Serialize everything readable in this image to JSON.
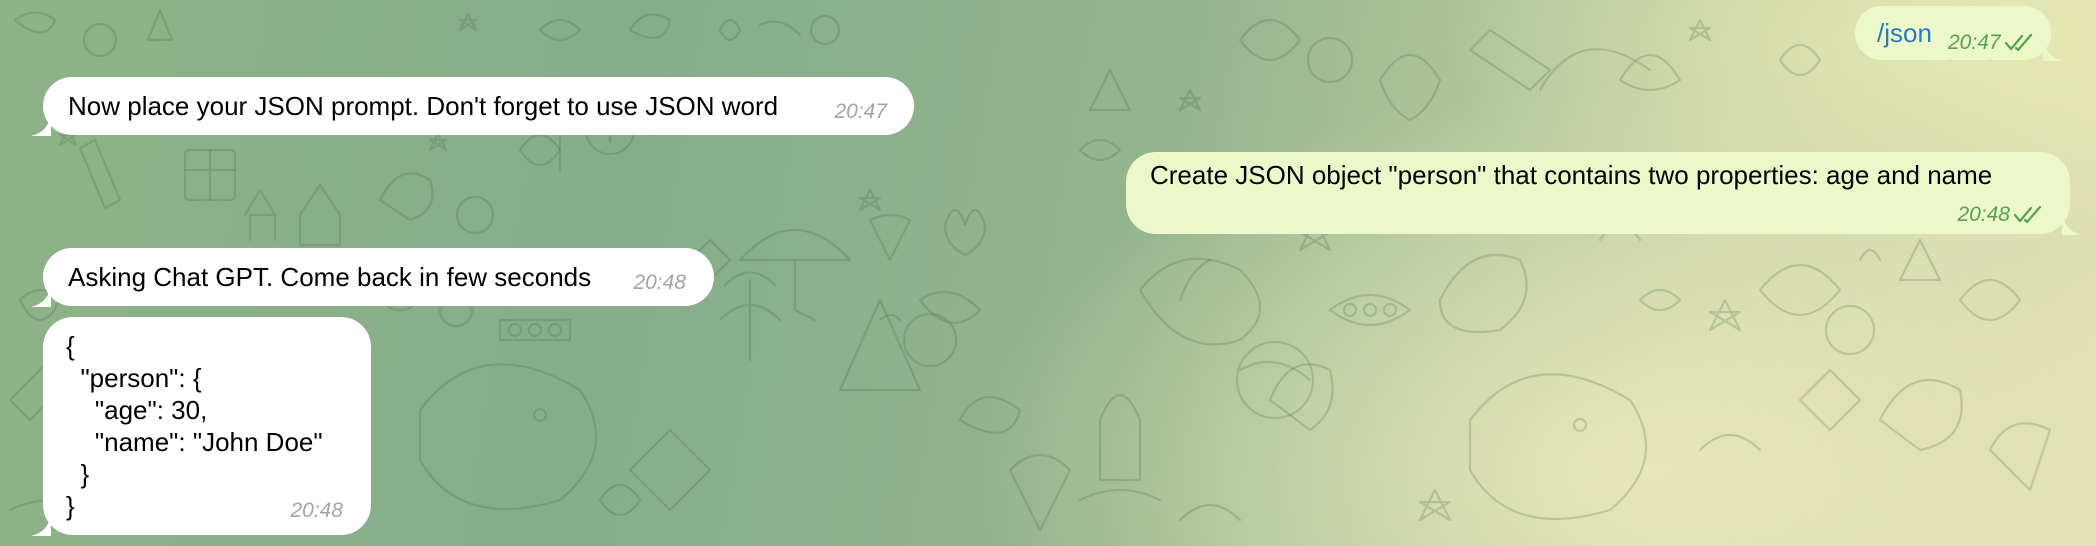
{
  "chat": {
    "messages": [
      {
        "direction": "outgoing",
        "text": "/json",
        "is_command": true,
        "time": "20:47",
        "status": "read"
      },
      {
        "direction": "incoming",
        "text": "Now place your JSON prompt. Don't forget to use JSON word",
        "time": "20:47"
      },
      {
        "direction": "outgoing",
        "text": "Create JSON object \"person\" that contains two properties: age and name",
        "time": "20:48",
        "status": "read"
      },
      {
        "direction": "incoming",
        "text": "Asking Chat GPT. Come back in few seconds",
        "time": "20:48"
      },
      {
        "direction": "incoming",
        "text": "{\n  \"person\": {\n    \"age\": 30,\n    \"name\": \"John Doe\"\n  }\n}",
        "time": "20:48"
      }
    ]
  },
  "colors": {
    "incoming_bubble": "#ffffff",
    "outgoing_bubble": "#ecf8c9",
    "command_link": "#2a7abf",
    "outgoing_meta": "#58a04e",
    "incoming_time": "#a4a4a4"
  },
  "icons": {
    "read_status": "double-check-icon",
    "background": "doodle-pattern"
  }
}
